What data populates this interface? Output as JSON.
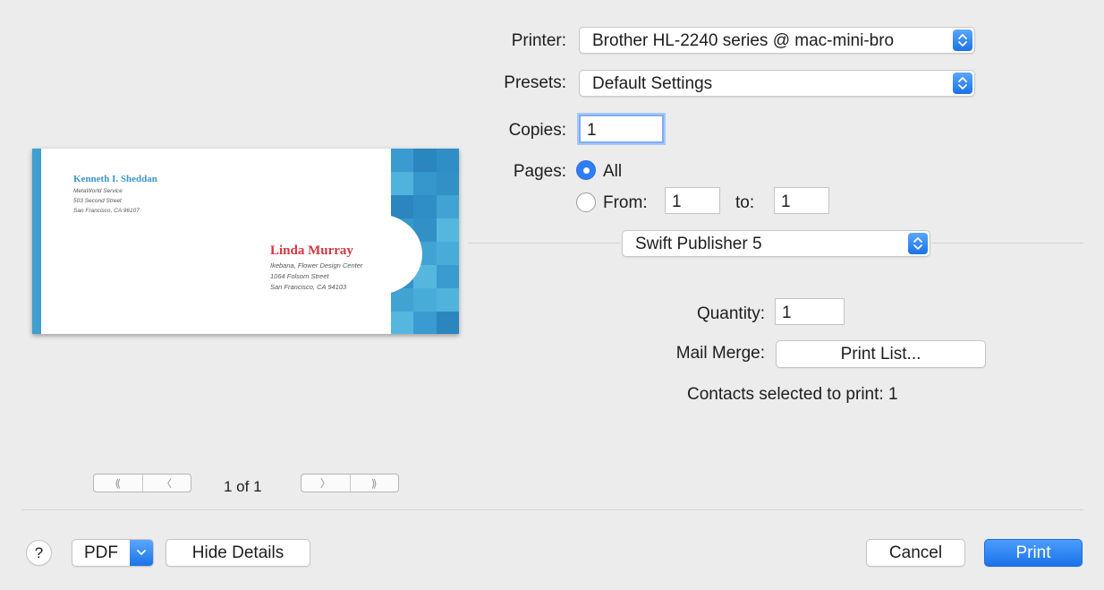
{
  "preview": {
    "sender": {
      "name": "Kenneth I. Sheddan",
      "lines": [
        "MetaWorld Service",
        "503 Second Street",
        "San Francisco, CA 96107"
      ]
    },
    "recipient": {
      "name": "Linda Murray",
      "lines": [
        "Ikebana, Flower Design Center",
        "1064 Folsom Street",
        "San Francisco, CA 94103"
      ]
    },
    "colors": {
      "stripe": "#3f9fcf",
      "sender_name": "#3b97c6",
      "recipient_name": "#d9343f"
    }
  },
  "page_nav": {
    "first_icon": "double-chevron-left-icon",
    "prev_icon": "chevron-left-icon",
    "next_icon": "chevron-right-icon",
    "last_icon": "double-chevron-right-icon",
    "indicator": "1 of 1"
  },
  "form": {
    "printer": {
      "label": "Printer:",
      "value": "Brother HL-2240 series @ mac-mini-bro"
    },
    "presets": {
      "label": "Presets:",
      "value": "Default Settings"
    },
    "copies": {
      "label": "Copies:",
      "value": "1"
    },
    "pages": {
      "label": "Pages:",
      "all_label": "All",
      "all_selected": true,
      "from_label": "From:",
      "from_value": "1",
      "to_label": "to:",
      "to_value": "1"
    },
    "section_popup": {
      "value": "Swift Publisher 5"
    },
    "quantity": {
      "label": "Quantity:",
      "value": "1"
    },
    "mail_merge": {
      "label": "Mail Merge:",
      "button": "Print List..."
    },
    "contacts_status": "Contacts selected to print: 1"
  },
  "footer": {
    "help": "?",
    "pdf": "PDF",
    "hide_details": "Hide Details",
    "cancel": "Cancel",
    "print": "Print"
  },
  "colors": {
    "accent": "#1a73e8",
    "background": "#ececec"
  }
}
